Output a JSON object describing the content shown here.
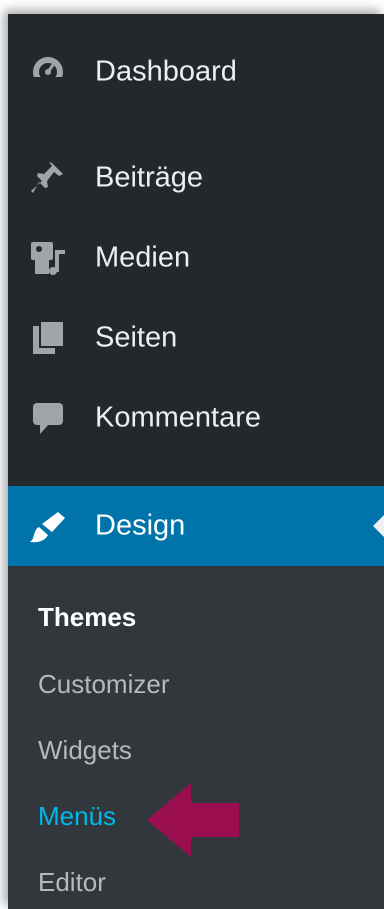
{
  "menu": {
    "items": [
      {
        "label": "Dashboard",
        "icon": "dashboard-icon"
      },
      {
        "label": "Beiträge",
        "icon": "pin-icon"
      },
      {
        "label": "Medien",
        "icon": "media-icon"
      },
      {
        "label": "Seiten",
        "icon": "pages-icon"
      },
      {
        "label": "Kommentare",
        "icon": "comments-icon"
      },
      {
        "label": "Design",
        "icon": "paintbrush-icon",
        "active": true
      }
    ]
  },
  "submenu": {
    "items": [
      {
        "label": "Themes",
        "state": "current"
      },
      {
        "label": "Customizer"
      },
      {
        "label": "Widgets"
      },
      {
        "label": "Menüs",
        "state": "hover"
      },
      {
        "label": "Editor"
      }
    ]
  },
  "annotation": {
    "arrow_icon": "left-arrow-icon",
    "arrow_color": "#9b0e4f"
  },
  "colors": {
    "sidebar_bg": "#23282d",
    "submenu_bg": "#32373c",
    "active_bg": "#0073aa",
    "hover_text": "#00b9eb"
  }
}
